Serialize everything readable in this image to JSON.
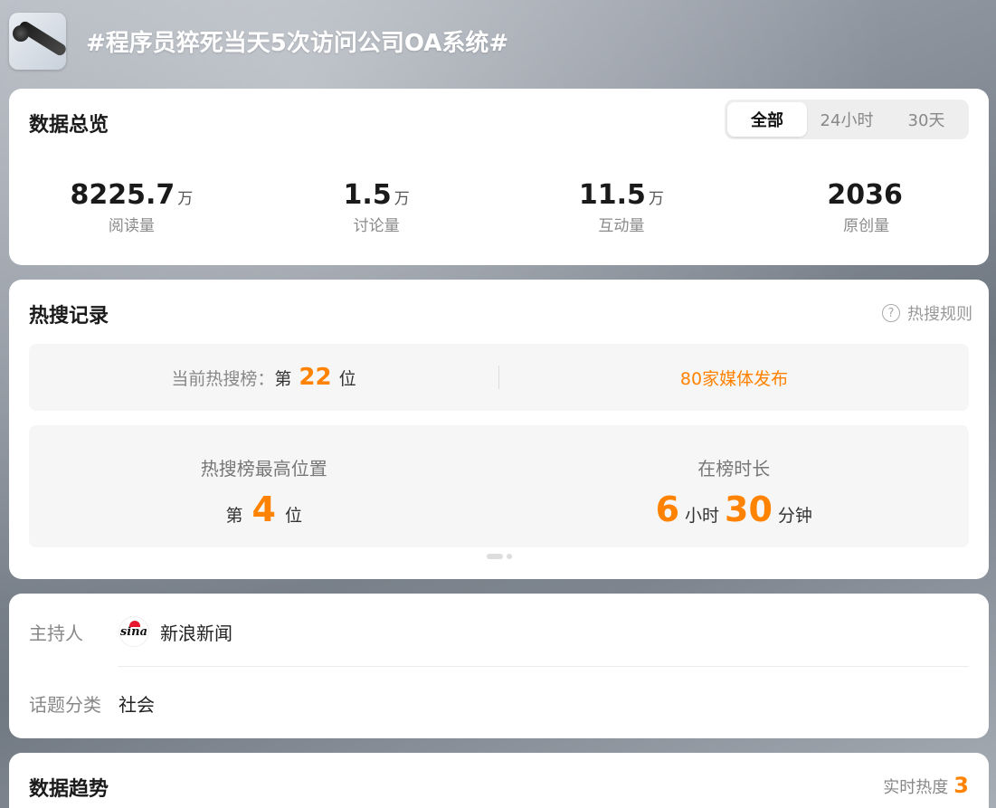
{
  "header": {
    "title": "#程序员猝死当天5次访问公司OA系统#"
  },
  "overview": {
    "title": "数据总览",
    "tabs": [
      {
        "label": "全部",
        "active": true
      },
      {
        "label": "24小时",
        "active": false
      },
      {
        "label": "30天",
        "active": false
      }
    ],
    "stats": [
      {
        "value": "8225.7",
        "unit": "万",
        "label": "阅读量"
      },
      {
        "value": "1.5",
        "unit": "万",
        "label": "讨论量"
      },
      {
        "value": "11.5",
        "unit": "万",
        "label": "互动量"
      },
      {
        "value": "2036",
        "unit": "",
        "label": "原创量"
      }
    ]
  },
  "hot_search": {
    "title": "热搜记录",
    "rules_label": "热搜规则",
    "current_label": "当前热搜榜：",
    "current_prefix": "第",
    "current_rank": "22",
    "current_suffix": "位",
    "media_text": "80家媒体发布",
    "peak_label": "热搜榜最高位置",
    "peak_prefix": "第",
    "peak_rank": "4",
    "peak_suffix": "位",
    "duration_label": "在榜时长",
    "duration_hours": "6",
    "hours_unit": "小时",
    "duration_minutes": "30",
    "minutes_unit": "分钟"
  },
  "host": {
    "host_label": "主持人",
    "host_logo_text": "sina",
    "host_name": "新浪新闻",
    "category_label": "话题分类",
    "category_value": "社会"
  },
  "trend": {
    "title": "数据趋势",
    "realtime_label": "实时热度",
    "realtime_value": "3"
  },
  "colors": {
    "accent": "#ff8200"
  }
}
